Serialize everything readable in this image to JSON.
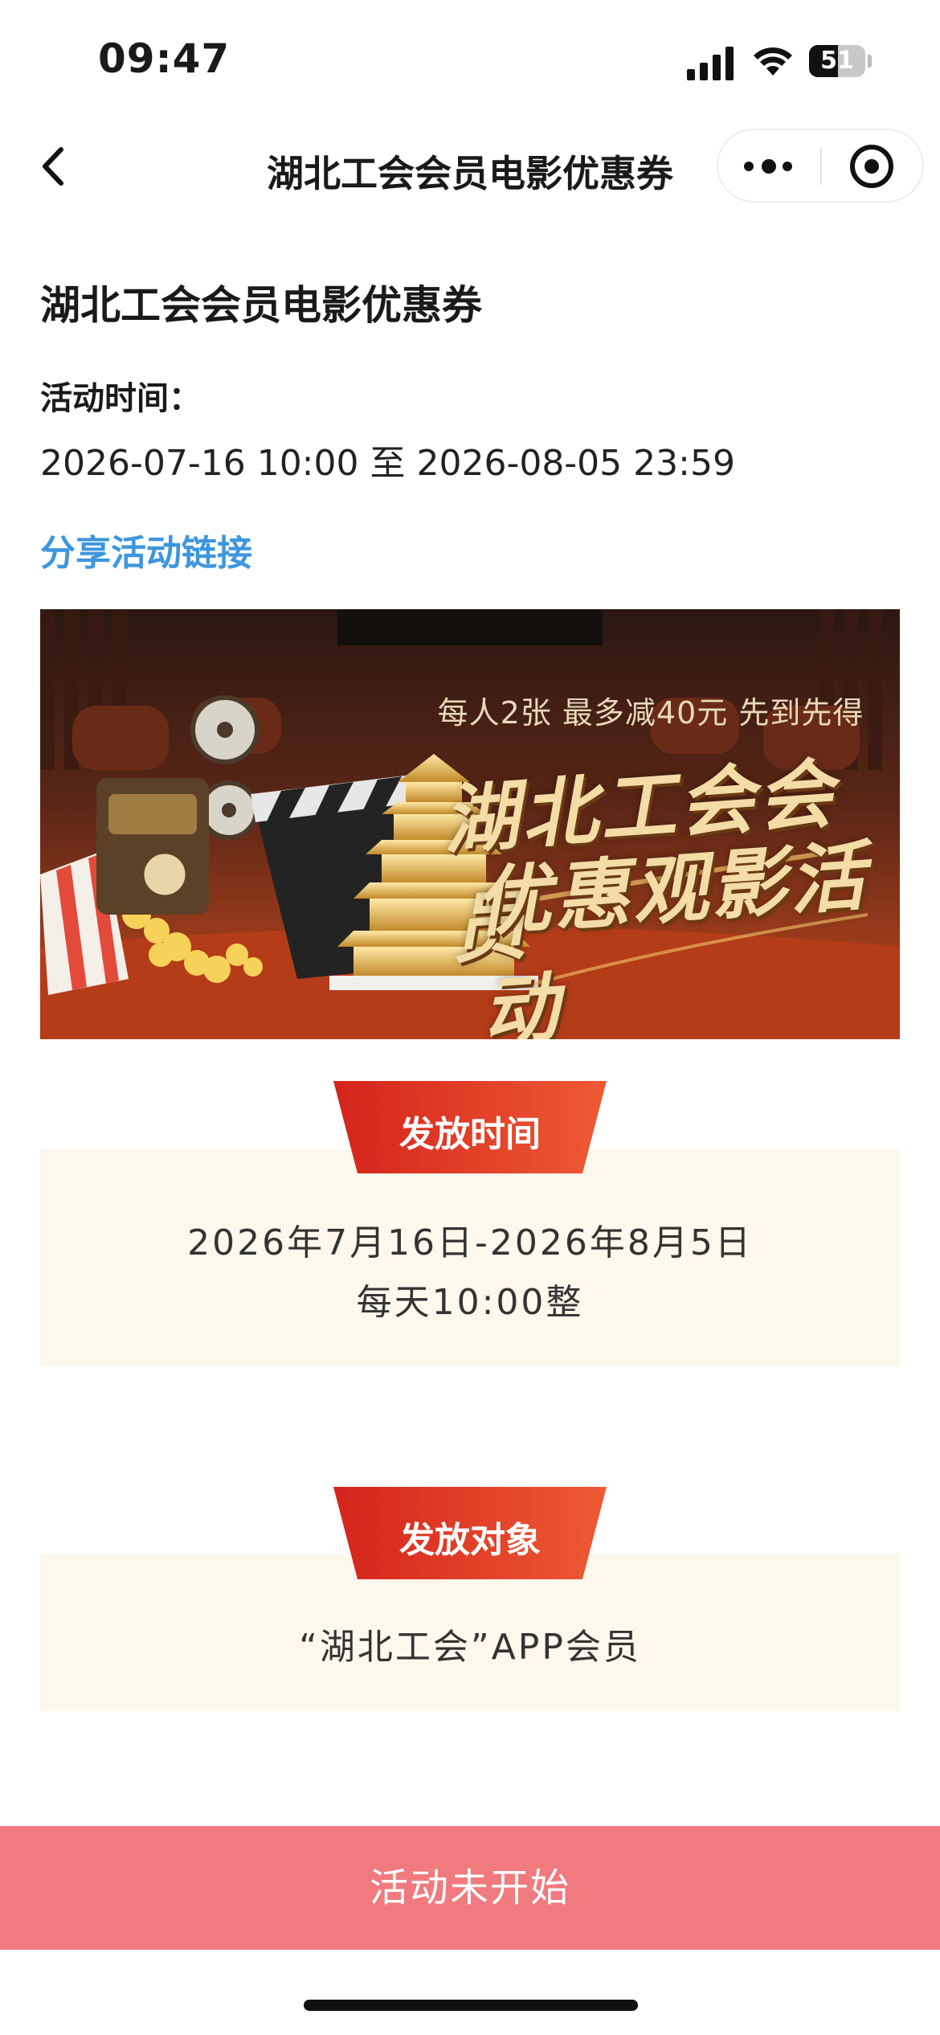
{
  "status_bar": {
    "time": "09:47",
    "battery": "51"
  },
  "nav": {
    "title": "湖北工会会员电影优惠券"
  },
  "page": {
    "title": "湖北工会会员电影优惠券",
    "time_label": "活动时间：",
    "time_range": "2026-07-16 10:00 至 2026-08-05 23:59",
    "share_link": "分享活动链接"
  },
  "banner": {
    "tagline": "每人2张 最多减40元 先到先得",
    "title_line1": "湖北工会会员",
    "title_line2": "优惠观影活动"
  },
  "sections": [
    {
      "heading": "发放时间",
      "lines": [
        "2026年7月16日-2026年8月5日",
        "每天10:00整"
      ]
    },
    {
      "heading": "发放对象",
      "lines": [
        "“湖北工会”APP会员"
      ]
    }
  ],
  "bottom_button": {
    "label": "活动未开始"
  },
  "colors": {
    "accent_red": "#e4392c",
    "link_blue": "#3d96de",
    "button_disabled": "#f07a7e",
    "section_bg": "#fdf7ec"
  },
  "icons": [
    "back-arrow-icon",
    "more-icon",
    "target-icon",
    "signal-icon",
    "wifi-icon",
    "battery-icon"
  ]
}
